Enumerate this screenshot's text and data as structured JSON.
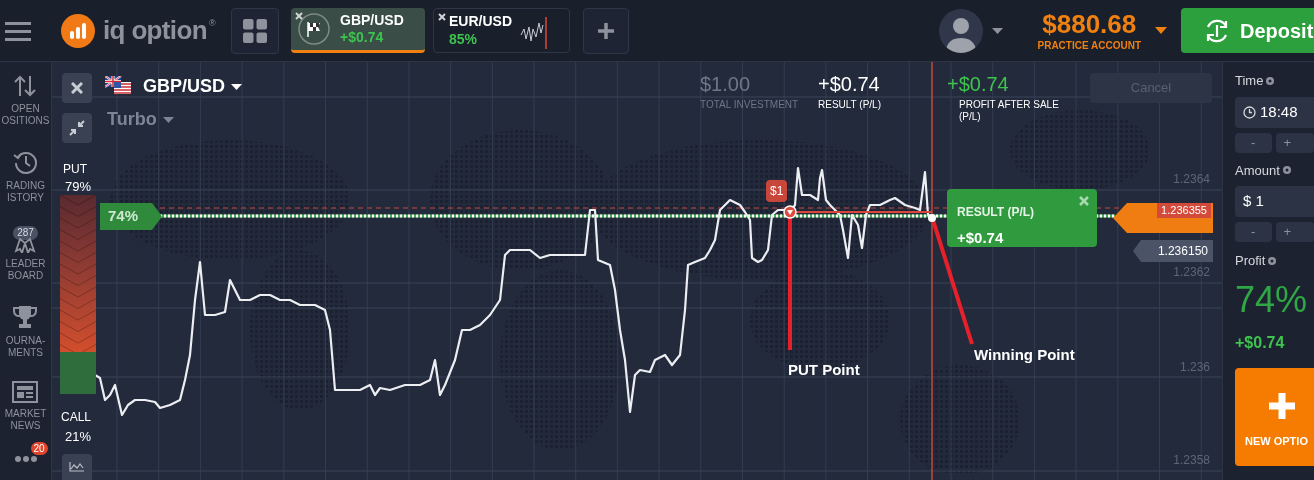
{
  "top_bar": {
    "logo": {
      "text": "iq option",
      "mark": "®"
    },
    "asset_tabs": [
      {
        "pair": "GBP/USD",
        "value": "+$0.74",
        "selected": true,
        "kind": "flag"
      },
      {
        "pair": "EUR/USD",
        "value": "85%",
        "selected": false,
        "kind": "mini_chart"
      }
    ],
    "balance": "$880.68",
    "account": "PRACTICE ACCOUNT",
    "deposit": "Deposit"
  },
  "sidebar": {
    "items": [
      {
        "label": "OPEN\nOSITIONS",
        "kind": "arrows"
      },
      {
        "label": "RADING\nISTORY",
        "kind": "history"
      },
      {
        "label": "LEADER\nBOARD",
        "kind": "leaderboard",
        "badge": "287"
      },
      {
        "label": "OURNA-\nMENTS",
        "kind": "trophy"
      },
      {
        "label": "MARKET\nNEWS",
        "kind": "news"
      }
    ],
    "more_badge": "20"
  },
  "chart": {
    "asset": "GBP/USD",
    "option_type": "Turbo",
    "put": {
      "label": "PUT",
      "percent": "79%"
    },
    "call": {
      "label": "CALL",
      "percent": "21%"
    },
    "sentiment": {
      "level": 0.79
    },
    "payout_tag": "74%",
    "stats": [
      {
        "value": "$1.00",
        "label": "TOTAL INVESTMENT",
        "kind": "muted"
      },
      {
        "value": "+$0.74",
        "label": "RESULT (P/L)",
        "kind": "plain"
      },
      {
        "value": "+$0.74",
        "label": "PROFIT AFTER SALE (P/L)",
        "kind": "profit"
      }
    ],
    "cancel": {
      "label": "Cancel",
      "disabled": true
    },
    "bet_marker": "$1",
    "result_card": {
      "title": "RESULT (P/L)",
      "value": "+$0.74"
    },
    "price_tags": [
      {
        "value": "1.236355",
        "kind": "current"
      },
      {
        "value": "1.236150",
        "kind": "level"
      }
    ],
    "axis_labels": [
      "1.2364",
      "1.2362",
      "1.236",
      "1.2358"
    ],
    "annotations": [
      {
        "kind": "put",
        "text": "PUT Point"
      },
      {
        "kind": "win",
        "text": "Winning Point"
      }
    ]
  },
  "trade_panel": {
    "time": {
      "label": "Time",
      "value": "18:48",
      "minus": "-",
      "plus": "+"
    },
    "amount": {
      "label": "Amount",
      "value": "$ 1",
      "minus": "-",
      "plus": "+"
    },
    "profit": {
      "label": "Profit",
      "percent": "74%",
      "value": "+$0.74"
    },
    "new_option": "NEW OPTIO"
  }
}
